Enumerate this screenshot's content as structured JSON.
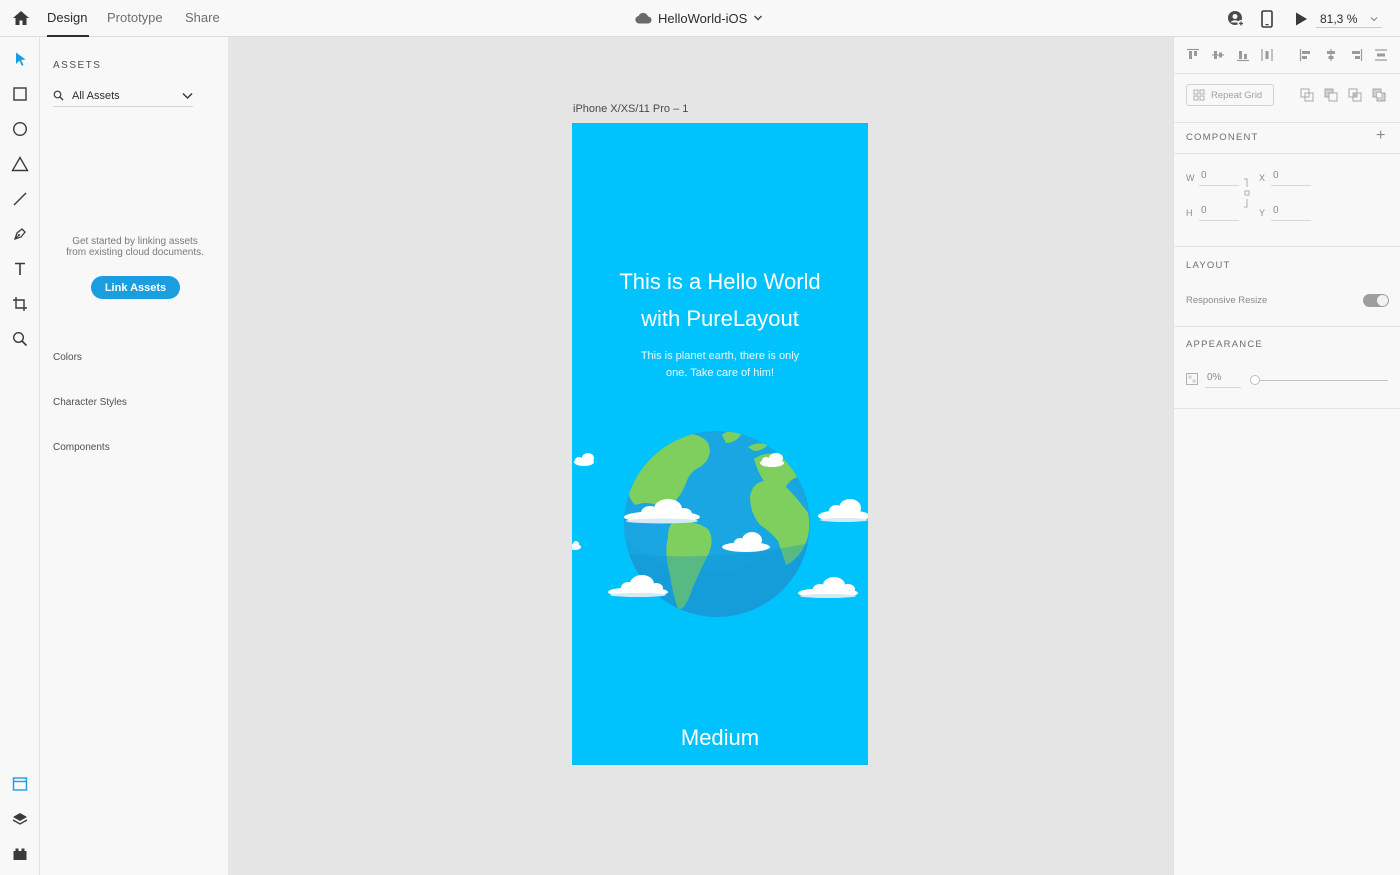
{
  "app": {
    "tabs": [
      {
        "label": "Design",
        "active": true
      },
      {
        "label": "Prototype",
        "active": false
      },
      {
        "label": "Share",
        "active": false
      }
    ],
    "document_title": "HelloWorld-iOS",
    "zoom": "81,3 %"
  },
  "toolbar": {
    "tools": [
      "select-tool",
      "rectangle-tool",
      "ellipse-tool",
      "polygon-tool",
      "line-tool",
      "pen-tool",
      "text-tool",
      "artboard-tool",
      "zoom-tool"
    ],
    "bottom": [
      "assets-panel",
      "layers-panel",
      "plugins-panel"
    ]
  },
  "assets": {
    "title": "ASSETS",
    "filter": "All Assets",
    "hint_line1": "Get started by linking assets",
    "hint_line2": "from existing cloud documents.",
    "link_button": "Link Assets",
    "sections": [
      "Colors",
      "Character Styles",
      "Components"
    ]
  },
  "canvas": {
    "artboard_name": "iPhone X/XS/11 Pro – 1",
    "artboard_color": "#00c3fd",
    "heading_line1": "This is a Hello World",
    "heading_line2": "with PureLayout",
    "sub_line1": "This is planet earth, there is only",
    "sub_line2": "one. Take care of him!",
    "footer": "Medium"
  },
  "inspector": {
    "repeat_grid": "Repeat Grid",
    "component_title": "COMPONENT",
    "w_label": "W",
    "w_value": "0",
    "x_label": "X",
    "x_value": "0",
    "h_label": "H",
    "h_value": "0",
    "y_label": "Y",
    "y_value": "0",
    "layout_title": "LAYOUT",
    "responsive_resize": "Responsive Resize",
    "appearance_title": "APPEARANCE",
    "opacity": "0%"
  },
  "colors": {
    "accent": "#1a9ee0",
    "earth_ocean": "#19a3e0",
    "earth_land": "#7fcf5e"
  }
}
